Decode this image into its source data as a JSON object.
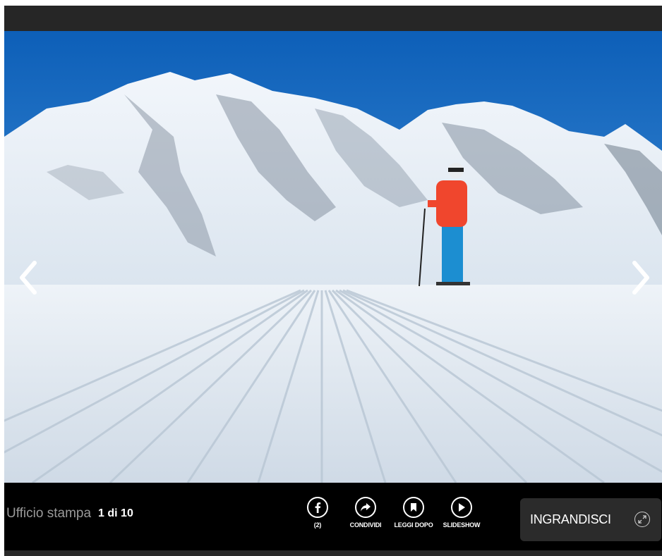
{
  "gallery": {
    "credit": "Ufficio stampa",
    "counter": "1 di 10",
    "photo_alt": "skier-on-groomed-slope-with-snowy-mountains",
    "prev_icon": "chevron-left-icon",
    "next_icon": "chevron-right-icon"
  },
  "actions": [
    {
      "icon": "facebook-icon",
      "label": "(2)"
    },
    {
      "icon": "share-icon",
      "label": "CONDIVIDI"
    },
    {
      "icon": "bookmark-icon",
      "label": "LEGGI DOPO"
    },
    {
      "icon": "play-icon",
      "label": "SLIDESHOW"
    }
  ],
  "enlarge": {
    "label": "INGRANDISCI",
    "icon": "expand-icon"
  },
  "colors": {
    "bar": "#000000",
    "frame": "#2a2a2a",
    "button": "#2b2b2b",
    "credit": "#9a9a9a"
  }
}
